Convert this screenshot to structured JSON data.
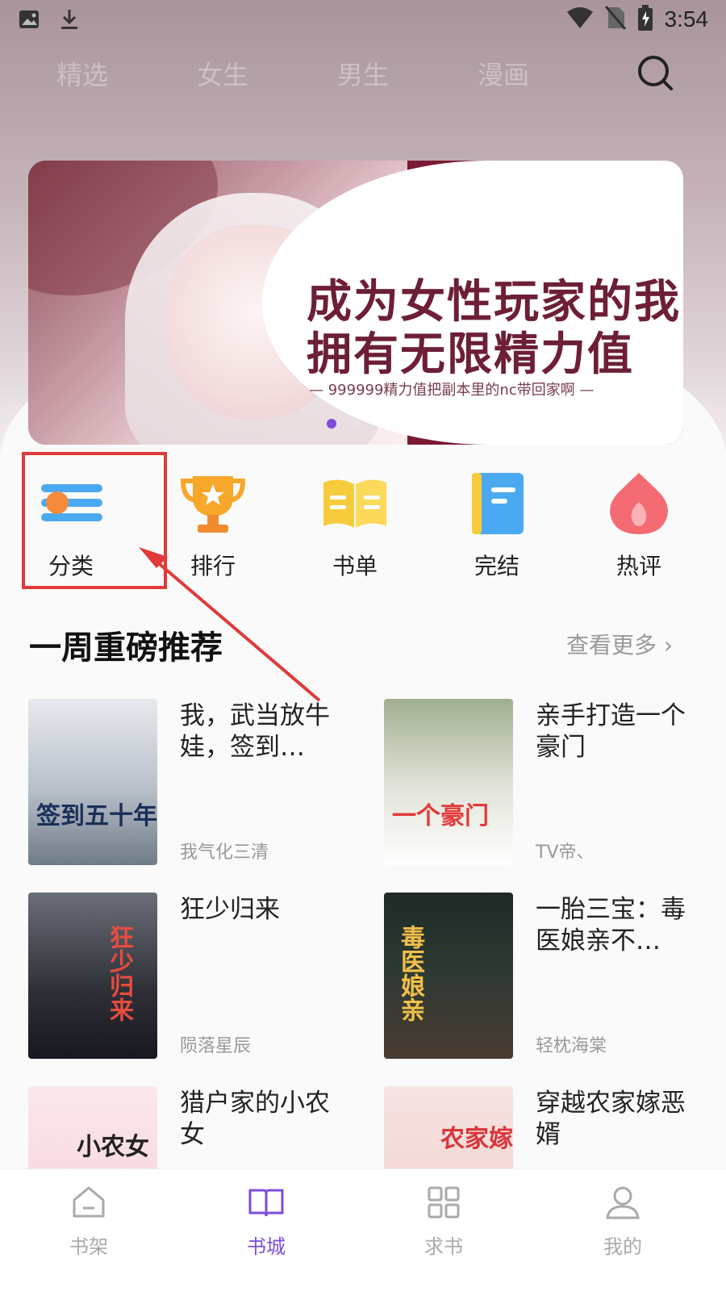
{
  "status_bar": {
    "time": "3:54"
  },
  "top_tabs": [
    "精选",
    "女生",
    "男生",
    "漫画"
  ],
  "banner": {
    "line1": "成为女性玩家的我",
    "line2": "拥有无限精力值",
    "subtitle": "— 999999精力值把副本里的nc带回家啊 —"
  },
  "categories": [
    "分类",
    "排行",
    "书单",
    "完结",
    "热评"
  ],
  "section": {
    "title": "一周重磅推荐",
    "more": "查看更多 ›"
  },
  "books": [
    {
      "title": "我，武当放牛娃，签到…",
      "author": "我气化三清",
      "cover_text": "签到五十年"
    },
    {
      "title": "亲手打造一个豪门",
      "author": "TV帝、",
      "cover_text": "一个豪门"
    },
    {
      "title": "狂少归来",
      "author": "陨落星辰",
      "cover_text": "狂少归来"
    },
    {
      "title": "一胎三宝：毒医娘亲不…",
      "author": "轻枕海棠",
      "cover_text": "毒医娘亲"
    },
    {
      "title": "猎户家的小农女",
      "author": "",
      "cover_text": "小农女"
    },
    {
      "title": "穿越农家嫁恶婿",
      "author": "",
      "cover_text": "农家嫁"
    }
  ],
  "bottom_nav": [
    "书架",
    "书城",
    "求书",
    "我的"
  ],
  "colors": {
    "accent": "#7d4cdb",
    "highlight": "#e03a3a"
  }
}
